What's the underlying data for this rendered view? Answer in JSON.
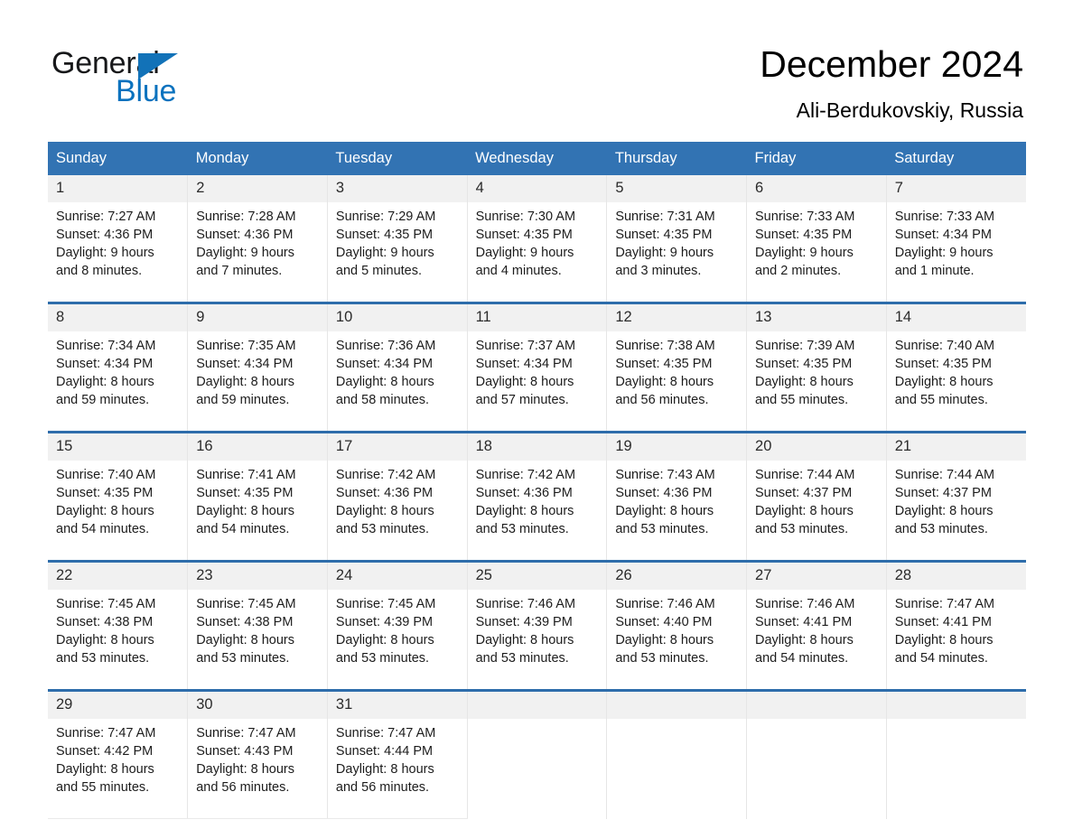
{
  "brand": {
    "name_part1": "General",
    "name_part2": "Blue",
    "accent_color": "#0a72be",
    "triangle_icon": "triangle-icon"
  },
  "header": {
    "title": "December 2024",
    "location": "Ali-Berdukovskiy, Russia"
  },
  "theme": {
    "header_blue": "#3273b3",
    "row_divider_blue": "#2e6dab",
    "day_number_band": "#f1f1f1"
  },
  "weekdays": [
    "Sunday",
    "Monday",
    "Tuesday",
    "Wednesday",
    "Thursday",
    "Friday",
    "Saturday"
  ],
  "weeks": [
    [
      {
        "day": "1",
        "sunrise": "Sunrise: 7:27 AM",
        "sunset": "Sunset: 4:36 PM",
        "daylight_line1": "Daylight: 9 hours",
        "daylight_line2": "and 8 minutes."
      },
      {
        "day": "2",
        "sunrise": "Sunrise: 7:28 AM",
        "sunset": "Sunset: 4:36 PM",
        "daylight_line1": "Daylight: 9 hours",
        "daylight_line2": "and 7 minutes."
      },
      {
        "day": "3",
        "sunrise": "Sunrise: 7:29 AM",
        "sunset": "Sunset: 4:35 PM",
        "daylight_line1": "Daylight: 9 hours",
        "daylight_line2": "and 5 minutes."
      },
      {
        "day": "4",
        "sunrise": "Sunrise: 7:30 AM",
        "sunset": "Sunset: 4:35 PM",
        "daylight_line1": "Daylight: 9 hours",
        "daylight_line2": "and 4 minutes."
      },
      {
        "day": "5",
        "sunrise": "Sunrise: 7:31 AM",
        "sunset": "Sunset: 4:35 PM",
        "daylight_line1": "Daylight: 9 hours",
        "daylight_line2": "and 3 minutes."
      },
      {
        "day": "6",
        "sunrise": "Sunrise: 7:33 AM",
        "sunset": "Sunset: 4:35 PM",
        "daylight_line1": "Daylight: 9 hours",
        "daylight_line2": "and 2 minutes."
      },
      {
        "day": "7",
        "sunrise": "Sunrise: 7:33 AM",
        "sunset": "Sunset: 4:34 PM",
        "daylight_line1": "Daylight: 9 hours",
        "daylight_line2": "and 1 minute."
      }
    ],
    [
      {
        "day": "8",
        "sunrise": "Sunrise: 7:34 AM",
        "sunset": "Sunset: 4:34 PM",
        "daylight_line1": "Daylight: 8 hours",
        "daylight_line2": "and 59 minutes."
      },
      {
        "day": "9",
        "sunrise": "Sunrise: 7:35 AM",
        "sunset": "Sunset: 4:34 PM",
        "daylight_line1": "Daylight: 8 hours",
        "daylight_line2": "and 59 minutes."
      },
      {
        "day": "10",
        "sunrise": "Sunrise: 7:36 AM",
        "sunset": "Sunset: 4:34 PM",
        "daylight_line1": "Daylight: 8 hours",
        "daylight_line2": "and 58 minutes."
      },
      {
        "day": "11",
        "sunrise": "Sunrise: 7:37 AM",
        "sunset": "Sunset: 4:34 PM",
        "daylight_line1": "Daylight: 8 hours",
        "daylight_line2": "and 57 minutes."
      },
      {
        "day": "12",
        "sunrise": "Sunrise: 7:38 AM",
        "sunset": "Sunset: 4:35 PM",
        "daylight_line1": "Daylight: 8 hours",
        "daylight_line2": "and 56 minutes."
      },
      {
        "day": "13",
        "sunrise": "Sunrise: 7:39 AM",
        "sunset": "Sunset: 4:35 PM",
        "daylight_line1": "Daylight: 8 hours",
        "daylight_line2": "and 55 minutes."
      },
      {
        "day": "14",
        "sunrise": "Sunrise: 7:40 AM",
        "sunset": "Sunset: 4:35 PM",
        "daylight_line1": "Daylight: 8 hours",
        "daylight_line2": "and 55 minutes."
      }
    ],
    [
      {
        "day": "15",
        "sunrise": "Sunrise: 7:40 AM",
        "sunset": "Sunset: 4:35 PM",
        "daylight_line1": "Daylight: 8 hours",
        "daylight_line2": "and 54 minutes."
      },
      {
        "day": "16",
        "sunrise": "Sunrise: 7:41 AM",
        "sunset": "Sunset: 4:35 PM",
        "daylight_line1": "Daylight: 8 hours",
        "daylight_line2": "and 54 minutes."
      },
      {
        "day": "17",
        "sunrise": "Sunrise: 7:42 AM",
        "sunset": "Sunset: 4:36 PM",
        "daylight_line1": "Daylight: 8 hours",
        "daylight_line2": "and 53 minutes."
      },
      {
        "day": "18",
        "sunrise": "Sunrise: 7:42 AM",
        "sunset": "Sunset: 4:36 PM",
        "daylight_line1": "Daylight: 8 hours",
        "daylight_line2": "and 53 minutes."
      },
      {
        "day": "19",
        "sunrise": "Sunrise: 7:43 AM",
        "sunset": "Sunset: 4:36 PM",
        "daylight_line1": "Daylight: 8 hours",
        "daylight_line2": "and 53 minutes."
      },
      {
        "day": "20",
        "sunrise": "Sunrise: 7:44 AM",
        "sunset": "Sunset: 4:37 PM",
        "daylight_line1": "Daylight: 8 hours",
        "daylight_line2": "and 53 minutes."
      },
      {
        "day": "21",
        "sunrise": "Sunrise: 7:44 AM",
        "sunset": "Sunset: 4:37 PM",
        "daylight_line1": "Daylight: 8 hours",
        "daylight_line2": "and 53 minutes."
      }
    ],
    [
      {
        "day": "22",
        "sunrise": "Sunrise: 7:45 AM",
        "sunset": "Sunset: 4:38 PM",
        "daylight_line1": "Daylight: 8 hours",
        "daylight_line2": "and 53 minutes."
      },
      {
        "day": "23",
        "sunrise": "Sunrise: 7:45 AM",
        "sunset": "Sunset: 4:38 PM",
        "daylight_line1": "Daylight: 8 hours",
        "daylight_line2": "and 53 minutes."
      },
      {
        "day": "24",
        "sunrise": "Sunrise: 7:45 AM",
        "sunset": "Sunset: 4:39 PM",
        "daylight_line1": "Daylight: 8 hours",
        "daylight_line2": "and 53 minutes."
      },
      {
        "day": "25",
        "sunrise": "Sunrise: 7:46 AM",
        "sunset": "Sunset: 4:39 PM",
        "daylight_line1": "Daylight: 8 hours",
        "daylight_line2": "and 53 minutes."
      },
      {
        "day": "26",
        "sunrise": "Sunrise: 7:46 AM",
        "sunset": "Sunset: 4:40 PM",
        "daylight_line1": "Daylight: 8 hours",
        "daylight_line2": "and 53 minutes."
      },
      {
        "day": "27",
        "sunrise": "Sunrise: 7:46 AM",
        "sunset": "Sunset: 4:41 PM",
        "daylight_line1": "Daylight: 8 hours",
        "daylight_line2": "and 54 minutes."
      },
      {
        "day": "28",
        "sunrise": "Sunrise: 7:47 AM",
        "sunset": "Sunset: 4:41 PM",
        "daylight_line1": "Daylight: 8 hours",
        "daylight_line2": "and 54 minutes."
      }
    ],
    [
      {
        "day": "29",
        "sunrise": "Sunrise: 7:47 AM",
        "sunset": "Sunset: 4:42 PM",
        "daylight_line1": "Daylight: 8 hours",
        "daylight_line2": "and 55 minutes."
      },
      {
        "day": "30",
        "sunrise": "Sunrise: 7:47 AM",
        "sunset": "Sunset: 4:43 PM",
        "daylight_line1": "Daylight: 8 hours",
        "daylight_line2": "and 56 minutes."
      },
      {
        "day": "31",
        "sunrise": "Sunrise: 7:47 AM",
        "sunset": "Sunset: 4:44 PM",
        "daylight_line1": "Daylight: 8 hours",
        "daylight_line2": "and 56 minutes."
      },
      {
        "day": "",
        "sunrise": "",
        "sunset": "",
        "daylight_line1": "",
        "daylight_line2": ""
      },
      {
        "day": "",
        "sunrise": "",
        "sunset": "",
        "daylight_line1": "",
        "daylight_line2": ""
      },
      {
        "day": "",
        "sunrise": "",
        "sunset": "",
        "daylight_line1": "",
        "daylight_line2": ""
      },
      {
        "day": "",
        "sunrise": "",
        "sunset": "",
        "daylight_line1": "",
        "daylight_line2": ""
      }
    ]
  ]
}
